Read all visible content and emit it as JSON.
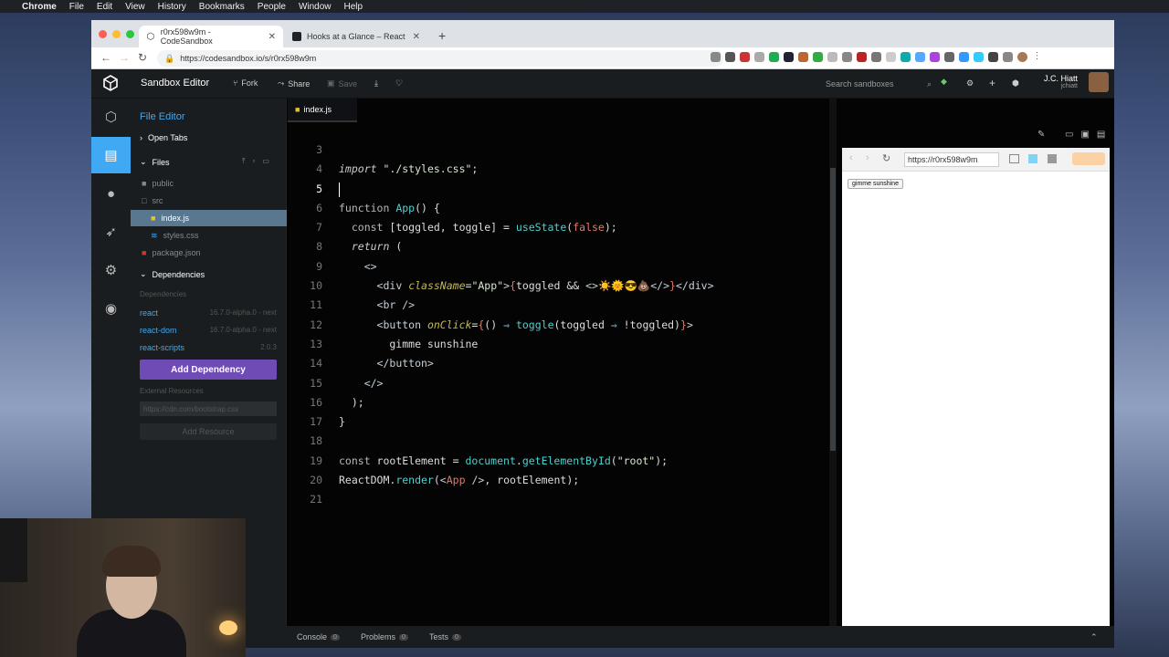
{
  "menubar": {
    "app": "Chrome",
    "items": [
      "File",
      "Edit",
      "View",
      "History",
      "Bookmarks",
      "People",
      "Window",
      "Help"
    ]
  },
  "browser": {
    "tabs": [
      {
        "title": "r0rx598w9m - CodeSandbox",
        "icon": "codesandbox-icon"
      },
      {
        "title": "Hooks at a Glance – React",
        "icon": "react-icon"
      }
    ],
    "url": "https://codesandbox.io/s/r0rx598w9m"
  },
  "header": {
    "title": "Sandbox Editor",
    "fork": "Fork",
    "share": "Share",
    "save": "Save",
    "search_placeholder": "Search sandboxes",
    "user_name": "J.C. Hiatt",
    "user_handle": "jchiatt"
  },
  "sidebar": {
    "heading": "File Editor",
    "open_tabs": "Open Tabs",
    "files": "Files",
    "file_list": [
      {
        "name": "public",
        "kind": "folder"
      },
      {
        "name": "src",
        "kind": "folder"
      },
      {
        "name": "index.js",
        "kind": "js"
      },
      {
        "name": "styles.css",
        "kind": "css"
      },
      {
        "name": "package.json",
        "kind": "json"
      }
    ],
    "dependencies_section": "Dependencies",
    "dependencies_label": "Dependencies",
    "dependencies": [
      {
        "name": "react",
        "version": "16.7.0-alpha.0 - next"
      },
      {
        "name": "react-dom",
        "version": "16.7.0-alpha.0 - next"
      },
      {
        "name": "react-scripts",
        "version": "2.0.3"
      }
    ],
    "add_dependency": "Add Dependency",
    "external_resources": "External Resources",
    "external_placeholder": "https://cdn.com/bootstrap.css",
    "add_resource": "Add Resource"
  },
  "editor": {
    "tab": "index.js",
    "current_line": "5"
  },
  "preview": {
    "url": "https://r0rx598w9m",
    "button": "gimme sunshine"
  },
  "status": {
    "console": "Console",
    "problems": "Problems",
    "tests": "Tests",
    "console_count": "0",
    "problems_count": "0",
    "tests_count": "0"
  },
  "colors": {
    "accent": "#40a9f3",
    "add_dependency": "#6f4bb6"
  }
}
